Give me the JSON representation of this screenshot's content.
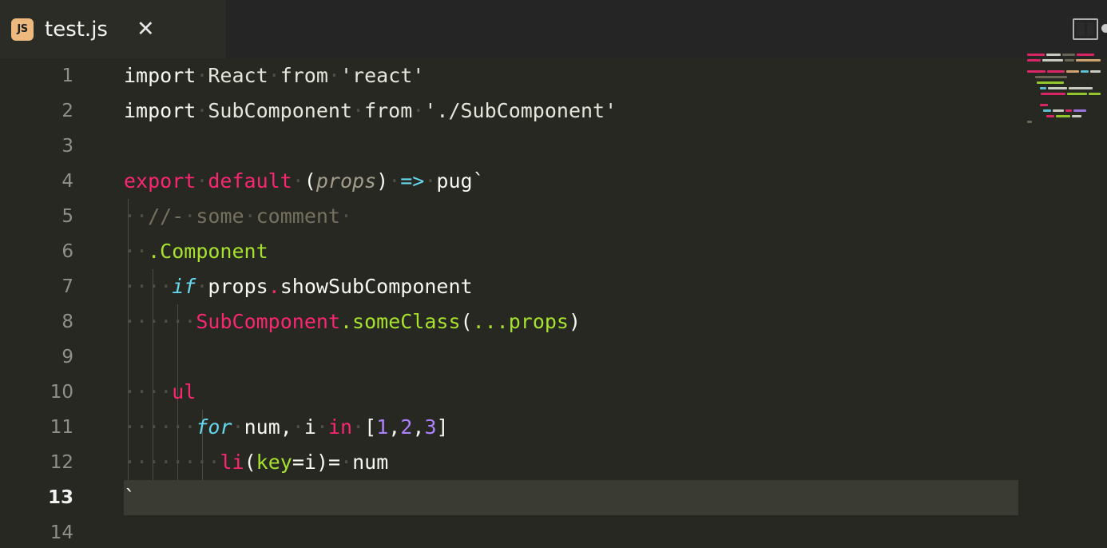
{
  "window": {
    "title": "test.js",
    "theme": "monokai"
  },
  "tab": {
    "label": "test.js",
    "file_type_badge": "JS",
    "close_label": "✕",
    "icon": "js-file-icon"
  },
  "toolbar": {
    "split_editor_label": "split-editor-icon",
    "more_actions_label": "more-actions-icon"
  },
  "colors": {
    "editor_background": "#272822",
    "tab_bar_background": "#252526",
    "active_tab_background": "#2b2c26",
    "active_line_background": "#3a3b32",
    "line_number": "#8f908a",
    "active_line_number": "#f2f2f2",
    "foreground": "#f8f8f2",
    "keyword": "#f92672",
    "function": "#a6e22e",
    "number": "#ae81ff",
    "operator": "#66d9ef",
    "comment": "#75715e",
    "string": "#e6e6dc",
    "parameter": "#a39e8c",
    "indent_guide": "#4b4c44",
    "whitespace_dot": "#4e4f45",
    "js_badge_background": "#edb97f"
  },
  "editor": {
    "active_line": 13,
    "total_visible_lines": 14,
    "line_numbers": [
      1,
      2,
      3,
      4,
      5,
      6,
      7,
      8,
      9,
      10,
      11,
      12,
      13,
      14
    ],
    "lines": [
      {
        "number": 1,
        "text": "import React from 'react'",
        "tokens": [
          {
            "t": "import",
            "c": "t-def"
          },
          {
            "t": "·",
            "c": "t-ws"
          },
          {
            "t": "React",
            "c": "t-str"
          },
          {
            "t": "·",
            "c": "t-ws"
          },
          {
            "t": "from",
            "c": "t-str"
          },
          {
            "t": "·",
            "c": "t-ws"
          },
          {
            "t": "'react'",
            "c": "t-str"
          }
        ]
      },
      {
        "number": 2,
        "text": "import SubComponent from './SubComponent'",
        "tokens": [
          {
            "t": "import",
            "c": "t-def"
          },
          {
            "t": "·",
            "c": "t-ws"
          },
          {
            "t": "SubComponent",
            "c": "t-str"
          },
          {
            "t": "·",
            "c": "t-ws"
          },
          {
            "t": "from",
            "c": "t-str"
          },
          {
            "t": "·",
            "c": "t-ws"
          },
          {
            "t": "'./SubComponent'",
            "c": "t-str"
          }
        ]
      },
      {
        "number": 3,
        "text": "",
        "tokens": []
      },
      {
        "number": 4,
        "text": "export default (props) => pug`",
        "tokens": [
          {
            "t": "export",
            "c": "t-key"
          },
          {
            "t": "·",
            "c": "t-ws"
          },
          {
            "t": "default",
            "c": "t-key"
          },
          {
            "t": "·",
            "c": "t-ws"
          },
          {
            "t": "(",
            "c": "t-def"
          },
          {
            "t": "props",
            "c": "t-par"
          },
          {
            "t": ")",
            "c": "t-def"
          },
          {
            "t": "·",
            "c": "t-ws"
          },
          {
            "t": "=>",
            "c": "t-op"
          },
          {
            "t": "·",
            "c": "t-ws"
          },
          {
            "t": "pug`",
            "c": "t-def"
          }
        ]
      },
      {
        "number": 5,
        "text": "  //- some comment ",
        "tokens": [
          {
            "t": "·",
            "c": "t-ws"
          },
          {
            "t": "·",
            "c": "t-ws"
          },
          {
            "t": "//-",
            "c": "t-com"
          },
          {
            "t": "·",
            "c": "t-ws"
          },
          {
            "t": "some",
            "c": "t-com"
          },
          {
            "t": "·",
            "c": "t-ws"
          },
          {
            "t": "comment",
            "c": "t-com"
          },
          {
            "t": "·",
            "c": "t-ws"
          }
        ]
      },
      {
        "number": 6,
        "text": "  .Component",
        "tokens": [
          {
            "t": "·",
            "c": "t-ws"
          },
          {
            "t": "·",
            "c": "t-ws"
          },
          {
            "t": ".Component",
            "c": "t-fn"
          }
        ]
      },
      {
        "number": 7,
        "text": "    if props.showSubComponent",
        "tokens": [
          {
            "t": "·",
            "c": "t-ws"
          },
          {
            "t": "·",
            "c": "t-ws"
          },
          {
            "t": "·",
            "c": "t-ws"
          },
          {
            "t": "·",
            "c": "t-ws"
          },
          {
            "t": "if",
            "c": "t-ital"
          },
          {
            "t": "·",
            "c": "t-ws"
          },
          {
            "t": "props",
            "c": "t-def"
          },
          {
            "t": ".",
            "c": "t-key"
          },
          {
            "t": "showSubComponent",
            "c": "t-def"
          }
        ]
      },
      {
        "number": 8,
        "text": "      SubComponent.someClass(...props)",
        "tokens": [
          {
            "t": "·",
            "c": "t-ws"
          },
          {
            "t": "·",
            "c": "t-ws"
          },
          {
            "t": "·",
            "c": "t-ws"
          },
          {
            "t": "·",
            "c": "t-ws"
          },
          {
            "t": "·",
            "c": "t-ws"
          },
          {
            "t": "·",
            "c": "t-ws"
          },
          {
            "t": "SubComponent",
            "c": "t-key"
          },
          {
            "t": ".someClass",
            "c": "t-fn"
          },
          {
            "t": "(",
            "c": "t-def"
          },
          {
            "t": "...props",
            "c": "t-fn"
          },
          {
            "t": ")",
            "c": "t-def"
          }
        ]
      },
      {
        "number": 9,
        "text": "",
        "tokens": []
      },
      {
        "number": 10,
        "text": "    ul",
        "tokens": [
          {
            "t": "·",
            "c": "t-ws"
          },
          {
            "t": "·",
            "c": "t-ws"
          },
          {
            "t": "·",
            "c": "t-ws"
          },
          {
            "t": "·",
            "c": "t-ws"
          },
          {
            "t": "ul",
            "c": "t-key"
          }
        ]
      },
      {
        "number": 11,
        "text": "      for num, i in [1,2,3]",
        "tokens": [
          {
            "t": "·",
            "c": "t-ws"
          },
          {
            "t": "·",
            "c": "t-ws"
          },
          {
            "t": "·",
            "c": "t-ws"
          },
          {
            "t": "·",
            "c": "t-ws"
          },
          {
            "t": "·",
            "c": "t-ws"
          },
          {
            "t": "·",
            "c": "t-ws"
          },
          {
            "t": "for",
            "c": "t-ital"
          },
          {
            "t": "·",
            "c": "t-ws"
          },
          {
            "t": "num,",
            "c": "t-def"
          },
          {
            "t": "·",
            "c": "t-ws"
          },
          {
            "t": "i",
            "c": "t-def"
          },
          {
            "t": "·",
            "c": "t-ws"
          },
          {
            "t": "in",
            "c": "t-key"
          },
          {
            "t": "·",
            "c": "t-ws"
          },
          {
            "t": "[",
            "c": "t-def"
          },
          {
            "t": "1",
            "c": "t-num"
          },
          {
            "t": ",",
            "c": "t-def"
          },
          {
            "t": "2",
            "c": "t-num"
          },
          {
            "t": ",",
            "c": "t-def"
          },
          {
            "t": "3",
            "c": "t-num"
          },
          {
            "t": "]",
            "c": "t-def"
          }
        ]
      },
      {
        "number": 12,
        "text": "        li(key=i)= num",
        "tokens": [
          {
            "t": "·",
            "c": "t-ws"
          },
          {
            "t": "·",
            "c": "t-ws"
          },
          {
            "t": "·",
            "c": "t-ws"
          },
          {
            "t": "·",
            "c": "t-ws"
          },
          {
            "t": "·",
            "c": "t-ws"
          },
          {
            "t": "·",
            "c": "t-ws"
          },
          {
            "t": "·",
            "c": "t-ws"
          },
          {
            "t": "·",
            "c": "t-ws"
          },
          {
            "t": "li",
            "c": "t-key"
          },
          {
            "t": "(",
            "c": "t-def"
          },
          {
            "t": "key",
            "c": "t-fn"
          },
          {
            "t": "=",
            "c": "t-def"
          },
          {
            "t": "i",
            "c": "t-def"
          },
          {
            "t": ")=",
            "c": "t-def"
          },
          {
            "t": "·",
            "c": "t-ws"
          },
          {
            "t": "num",
            "c": "t-def"
          }
        ]
      },
      {
        "number": 13,
        "text": "`",
        "tokens": [
          {
            "t": "`",
            "c": "t-def"
          }
        ]
      },
      {
        "number": 14,
        "text": "",
        "tokens": []
      }
    ]
  },
  "minimap": {
    "name": "code-minimap",
    "rows": [
      [
        {
          "w": 22,
          "c": "#f92672"
        },
        {
          "w": 18,
          "c": "#e6e6dc"
        },
        {
          "w": 16,
          "c": "#75715e"
        },
        {
          "w": 22,
          "c": "#f92672"
        }
      ],
      [
        {
          "w": 22,
          "c": "#f92672"
        },
        {
          "w": 34,
          "c": "#e6e6dc"
        },
        {
          "w": 16,
          "c": "#75715e"
        },
        {
          "w": 40,
          "c": "#edb97f"
        }
      ],
      [],
      [
        {
          "w": 26,
          "c": "#f92672"
        },
        {
          "w": 24,
          "c": "#f92672"
        },
        {
          "w": 18,
          "c": "#edb97f"
        },
        {
          "w": 12,
          "c": "#66d9ef"
        },
        {
          "w": 14,
          "c": "#e6e6dc"
        }
      ],
      [
        {
          "w": 8,
          "c": "#272822"
        },
        {
          "w": 40,
          "c": "#75715e"
        }
      ],
      [
        {
          "w": 10,
          "c": "#272822"
        },
        {
          "w": 34,
          "c": "#a6e22e"
        }
      ],
      [
        {
          "w": 14,
          "c": "#272822"
        },
        {
          "w": 8,
          "c": "#66d9ef"
        },
        {
          "w": 24,
          "c": "#e6e6dc"
        },
        {
          "w": 30,
          "c": "#e6e6dc"
        }
      ],
      [
        {
          "w": 18,
          "c": "#272822"
        },
        {
          "w": 36,
          "c": "#f92672"
        },
        {
          "w": 30,
          "c": "#a6e22e"
        },
        {
          "w": 18,
          "c": "#a6e22e"
        }
      ],
      [],
      [
        {
          "w": 14,
          "c": "#272822"
        },
        {
          "w": 10,
          "c": "#f92672"
        }
      ],
      [
        {
          "w": 18,
          "c": "#272822"
        },
        {
          "w": 10,
          "c": "#66d9ef"
        },
        {
          "w": 14,
          "c": "#e6e6dc"
        },
        {
          "w": 8,
          "c": "#f92672"
        },
        {
          "w": 16,
          "c": "#ae81ff"
        }
      ],
      [
        {
          "w": 22,
          "c": "#272822"
        },
        {
          "w": 10,
          "c": "#f92672"
        },
        {
          "w": 18,
          "c": "#a6e22e"
        },
        {
          "w": 12,
          "c": "#e6e6dc"
        }
      ],
      [
        {
          "w": 6,
          "c": "#75715e"
        }
      ]
    ]
  }
}
